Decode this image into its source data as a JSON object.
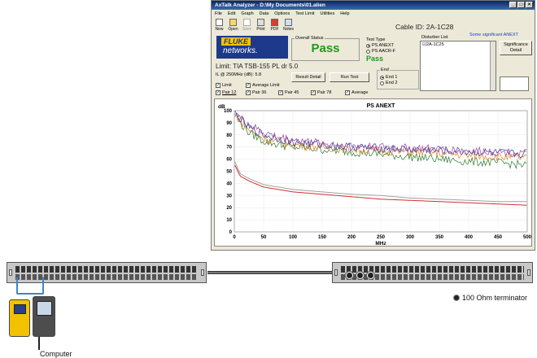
{
  "window": {
    "title": "AxTalk Analyzer - D:\\My Documents\\01.alien",
    "controls": [
      "_",
      "□",
      "×"
    ],
    "menu": [
      "File",
      "Edit",
      "Graph",
      "Data",
      "Options",
      "Test Limit",
      "Utilities",
      "Help"
    ],
    "toolbar": [
      "New",
      "Open",
      "Save",
      "Print",
      "PDF",
      "Notes"
    ]
  },
  "cable_id": "Cable ID: 2A-1C28",
  "logo": {
    "line1": "FLUKE",
    "line2": "networks."
  },
  "overall_status": {
    "label": "Overall Status",
    "value": "Pass"
  },
  "test_type": {
    "label": "Test Type",
    "options": [
      "PS ANEXT",
      "PS AACR-F"
    ],
    "selected": "PS ANEXT",
    "result": "Pass"
  },
  "disturber": {
    "label": "Disturber List",
    "items": [
      "2A-1C25"
    ],
    "significant_label": "Some significant ANEXT",
    "button": "Significance Detail"
  },
  "limit": "Limit: TIA TSB-155 PL dr 5.0",
  "il": {
    "label": "IL @ 250MHz (dB):",
    "value": "5.8"
  },
  "buttons": {
    "result_detail": "Result Detail",
    "run_test": "Run Test"
  },
  "end": {
    "label": "End",
    "options": [
      "End 1",
      "End 2"
    ],
    "selected": "End 1"
  },
  "checks": {
    "limit": "Limit",
    "average_limit": "Average Limit",
    "pairs": [
      "Pair 12",
      "Pair 36",
      "Pair 45",
      "Pair 78"
    ],
    "average": "Average"
  },
  "legend_terminator": "100 Ohm terminator",
  "computer_label": "Computer",
  "chart_data": {
    "type": "line",
    "title": "PS ANEXT",
    "ylabel": "dB",
    "xlabel": "MHz",
    "xlim": [
      0,
      500
    ],
    "ylim": [
      0,
      100
    ],
    "xticks": [
      0,
      50,
      100,
      150,
      200,
      250,
      300,
      350,
      400,
      450,
      500
    ],
    "yticks": [
      0,
      10,
      20,
      30,
      40,
      50,
      60,
      70,
      80,
      90,
      100
    ],
    "grid": true,
    "x": [
      1,
      10,
      25,
      50,
      75,
      100,
      150,
      200,
      250,
      300,
      350,
      400,
      450,
      500
    ],
    "series": [
      {
        "color": "#d03030",
        "values": [
          55,
          46,
          42,
          37,
          35,
          33,
          31,
          29,
          27,
          26,
          25,
          24,
          23,
          22
        ]
      },
      {
        "color": "#a0a0a0",
        "values": [
          58,
          48,
          44,
          39,
          37,
          35,
          33,
          31,
          30,
          28,
          27,
          26,
          25,
          25
        ]
      },
      {
        "color": "#2a7a2a",
        "values": [
          98,
          90,
          82,
          75,
          72,
          70,
          68,
          66,
          64,
          62,
          60,
          58,
          57,
          55
        ]
      },
      {
        "color": "#e08020",
        "values": [
          97,
          92,
          84,
          77,
          74,
          72,
          70,
          68,
          67,
          66,
          65,
          63,
          62,
          61
        ]
      },
      {
        "color": "#2a3aa0",
        "values": [
          99,
          93,
          86,
          80,
          77,
          74,
          72,
          70,
          69,
          68,
          67,
          66,
          65,
          64
        ]
      },
      {
        "color": "#a040a0",
        "values": [
          98,
          94,
          88,
          82,
          78,
          76,
          73,
          71,
          70,
          69,
          68,
          67,
          66,
          65
        ]
      }
    ]
  }
}
